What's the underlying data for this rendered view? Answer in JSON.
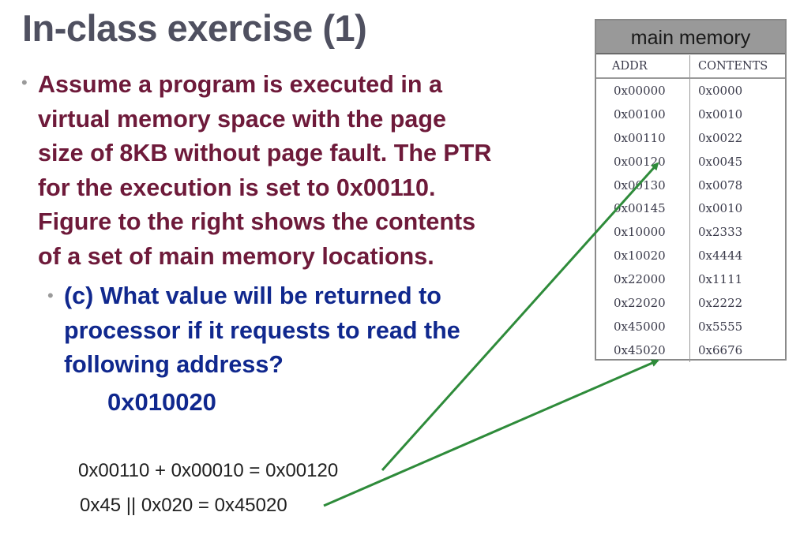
{
  "title": "In-class exercise (1)",
  "bullet_main": {
    "lines": [
      "Assume a program is executed in a",
      "virtual memory space with the page",
      "size of 8KB without page fault. The PTR",
      "for the execution is set to 0x00110.",
      "Figure to the right shows the contents",
      "of a set of main memory locations."
    ]
  },
  "bullet_sub": {
    "lines": [
      "(c) What value will be returned to",
      "processor if it requests to read the",
      "following address?"
    ]
  },
  "requested_address": "0x010020",
  "calculations": {
    "line1": "0x00110 + 0x00010 = 0x00120",
    "line2": "0x45 || 0x020 = 0x45020"
  },
  "memory": {
    "title": "main memory",
    "headers": {
      "addr": "ADDR",
      "contents": "CONTENTS"
    },
    "rows": [
      {
        "addr": "0x00000",
        "contents": "0x0000"
      },
      {
        "addr": "0x00100",
        "contents": "0x0010"
      },
      {
        "addr": "0x00110",
        "contents": "0x0022"
      },
      {
        "addr": "0x00120",
        "contents": "0x0045"
      },
      {
        "addr": "0x00130",
        "contents": "0x0078"
      },
      {
        "addr": "0x00145",
        "contents": "0x0010"
      },
      {
        "addr": "0x10000",
        "contents": "0x2333"
      },
      {
        "addr": "0x10020",
        "contents": "0x4444"
      },
      {
        "addr": "0x22000",
        "contents": "0x1111"
      },
      {
        "addr": "0x22020",
        "contents": "0x2222"
      },
      {
        "addr": "0x45000",
        "contents": "0x5555"
      },
      {
        "addr": "0x45020",
        "contents": "0x6676"
      }
    ]
  },
  "colors": {
    "title": "#4f5060",
    "main_text": "#6e1a3a",
    "sub_text": "#10288e",
    "arrow": "#2e8b3a"
  }
}
